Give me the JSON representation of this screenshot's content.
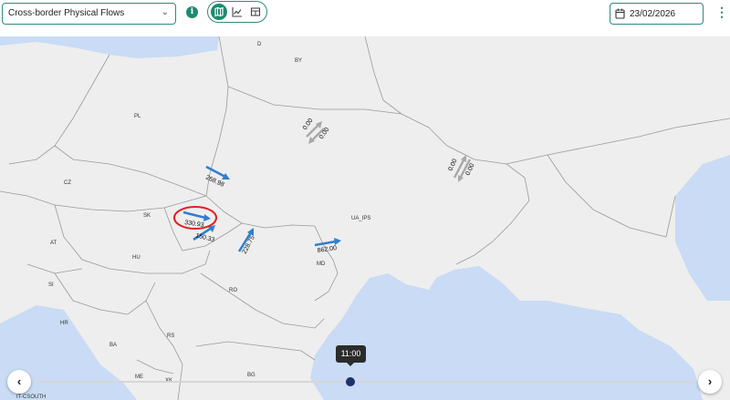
{
  "toolbar": {
    "dataset_select": "Cross-border Physical Flows",
    "date_value": "23/02/2026"
  },
  "map": {
    "country_labels": [
      "D",
      "BY",
      "PL",
      "CZ",
      "SK",
      "AT",
      "HU",
      "SI",
      "HR",
      "BA",
      "RS",
      "RO",
      "MD",
      "UA_IPS",
      "BG",
      "ME",
      "XK",
      "IT-CSOUTH"
    ],
    "flows": [
      {
        "from": "PL",
        "to": "UA_IPS",
        "value": "268.98"
      },
      {
        "from": "SK",
        "to": "UA_IPS",
        "value": "330.93",
        "highlighted": true
      },
      {
        "from": "HU",
        "to": "UA_IPS",
        "value": "150.33"
      },
      {
        "from": "RO",
        "to": "UA_IPS",
        "value": "228.75"
      },
      {
        "from": "MD",
        "to": "UA_IPS",
        "value": "862.00"
      },
      {
        "from": "BY",
        "to": "UA_IPS",
        "value": "0.00",
        "reverse_value": "0.00"
      },
      {
        "from": "RU",
        "to": "UA_IPS",
        "value": "0.00",
        "reverse_value": "0.00"
      }
    ],
    "colors": {
      "land": "#eeeeee",
      "sea": "#c9dbf5",
      "border": "#9a9a9a",
      "flow_arrow": "#2f7fd0",
      "zero_arrow": "#a8a8a8",
      "highlight_ring": "#e02020"
    }
  },
  "timeline": {
    "time_tooltip": "11:00",
    "prev_label": "‹",
    "next_label": "›"
  }
}
